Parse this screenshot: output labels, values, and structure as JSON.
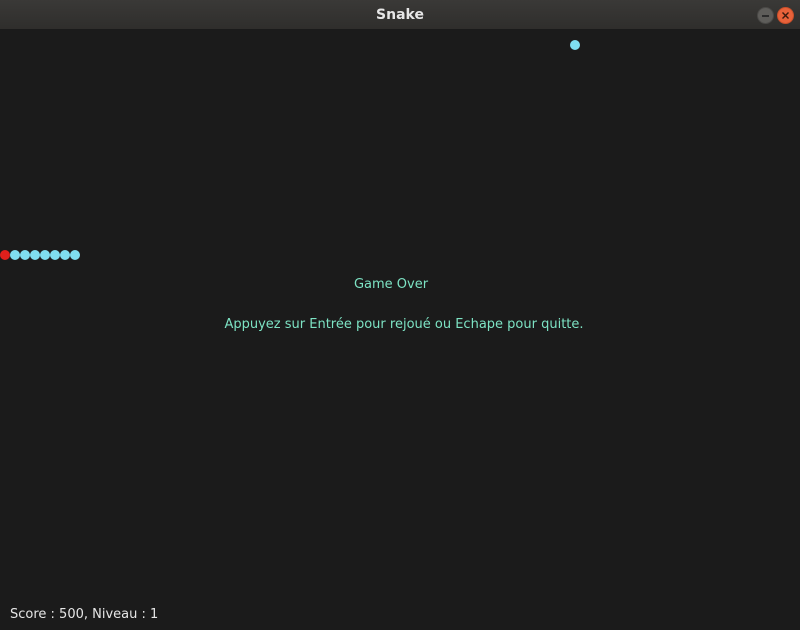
{
  "window": {
    "title": "Snake"
  },
  "game": {
    "game_over_text": "Game Over",
    "instructions_text": "Appuyez sur Entrée pour rejoué ou Echape pour quitte.",
    "status_text": "Score : 500, Niveau : 1",
    "colors": {
      "background": "#1b1b1b",
      "snake_head": "#e0201c",
      "snake_body": "#7fdef0",
      "food": "#7fdef0",
      "message": "#7de3c4",
      "status": "#e6e6e6"
    },
    "snake_length": 8
  }
}
